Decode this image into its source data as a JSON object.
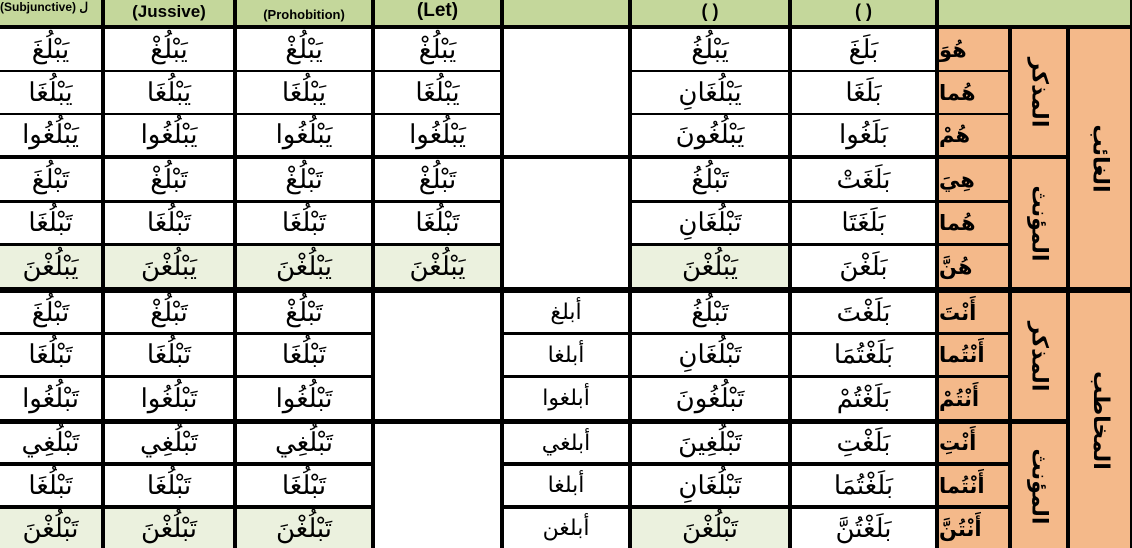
{
  "headers": {
    "subjunctive": "(Subjunctive) ل",
    "jussive": "(Jussive)",
    "prohibition": "(Prohobition)",
    "let": "(Let)",
    "imperative": "",
    "present": "( )",
    "past": "( )",
    "person": ""
  },
  "colors": {
    "header_bg": "#c4d79b",
    "pronoun_bg": "#f4b98a",
    "highlight_row_bg": "#ebf1de",
    "cell_bg": "#ffffff",
    "border": "#000000"
  },
  "groups": {
    "third_person": "الغائب",
    "second_person": "المخاطب",
    "masculine_3": "المذكر",
    "feminine_3": "المؤنث",
    "masculine_2": "المذكر",
    "feminine_2": "المؤنث"
  },
  "rows": [
    {
      "pronoun": "هُوَ",
      "past": "بَلَغَ",
      "present": "يَبْلُغُ",
      "imperative": "",
      "let": "يَبْلُغْ",
      "prohibition": "يَبْلُغْ",
      "jussive": "يَبْلُغْ",
      "subjunctive": "يَبْلُغَ"
    },
    {
      "pronoun": "هُما",
      "past": "بَلَغَا",
      "present": "يَبْلُغَانِ",
      "imperative": "",
      "let": "يَبْلُغَا",
      "prohibition": "يَبْلُغَا",
      "jussive": "يَبْلُغَا",
      "subjunctive": "يَبْلُغَا"
    },
    {
      "pronoun": "هُمْ",
      "past": "بَلَغُوا",
      "present": "يَبْلُغُونَ",
      "imperative": "",
      "let": "يَبْلُغُوا",
      "prohibition": "يَبْلُغُوا",
      "jussive": "يَبْلُغُوا",
      "subjunctive": "يَبْلُغُوا"
    },
    {
      "pronoun": "هِيَ",
      "past": "بَلَغَتْ",
      "present": "تَبْلُغُ",
      "imperative": "",
      "let": "تَبْلُغْ",
      "prohibition": "تَبْلُغْ",
      "jussive": "تَبْلُغْ",
      "subjunctive": "تَبْلُغَ"
    },
    {
      "pronoun": "هُما",
      "past": "بَلَغَتَا",
      "present": "تَبْلُغَانِ",
      "imperative": "",
      "let": "تَبْلُغَا",
      "prohibition": "تَبْلُغَا",
      "jussive": "تَبْلُغَا",
      "subjunctive": "تَبْلُغَا"
    },
    {
      "pronoun": "هُنَّ",
      "past": "بَلَغْنَ",
      "present": "يَبْلُغْنَ",
      "imperative": "",
      "let": "يَبْلُغْنَ",
      "prohibition": "يَبْلُغْنَ",
      "jussive": "يَبْلُغْنَ",
      "subjunctive": "يَبْلُغْنَ"
    },
    {
      "pronoun": "أَنْتَ",
      "past": "بَلَغْتَ",
      "present": "تَبْلُغُ",
      "imperative": "أبلغ",
      "let": "",
      "prohibition": "تَبْلُغْ",
      "jussive": "تَبْلُغْ",
      "subjunctive": "تَبْلُغَ"
    },
    {
      "pronoun": "أَنْتُما",
      "past": "بَلَغْتُمَا",
      "present": "تَبْلُغَانِ",
      "imperative": "أبلغا",
      "let": "",
      "prohibition": "تَبْلُغَا",
      "jussive": "تَبْلُغَا",
      "subjunctive": "تَبْلُغَا"
    },
    {
      "pronoun": "أَنْتُمْ",
      "past": "بَلَغْتُمْ",
      "present": "تَبْلُغُونَ",
      "imperative": "أبلغوا",
      "let": "",
      "prohibition": "تَبْلُغُوا",
      "jussive": "تَبْلُغُوا",
      "subjunctive": "تَبْلُغُوا"
    },
    {
      "pronoun": "أَنْتِ",
      "past": "بَلَغْتِ",
      "present": "تَبْلُغِينَ",
      "imperative": "أبلغي",
      "let": "",
      "prohibition": "تَبْلُغِي",
      "jussive": "تَبْلُغِي",
      "subjunctive": "تَبْلُغِي"
    },
    {
      "pronoun": "أَنْتُما",
      "past": "بَلَغْتُمَا",
      "present": "تَبْلُغَانِ",
      "imperative": "أبلغا",
      "let": "",
      "prohibition": "تَبْلُغَا",
      "jussive": "تَبْلُغَا",
      "subjunctive": "تَبْلُغَا"
    },
    {
      "pronoun": "أَنْتُنَّ",
      "past": "بَلَغْتُنَّ",
      "present": "تَبْلُغْنَ",
      "imperative": "أبلغن",
      "let": "",
      "prohibition": "تَبْلُغْنَ",
      "jussive": "تَبْلُغْنَ",
      "subjunctive": "تَبْلُغْنَ"
    }
  ]
}
